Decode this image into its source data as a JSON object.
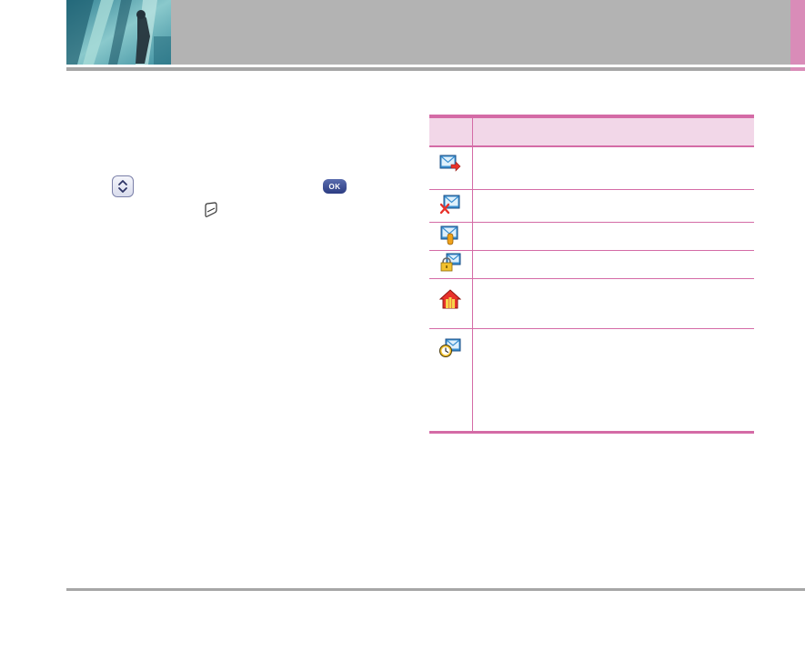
{
  "header": {
    "title": "",
    "photo_icon": "header-photo-icon"
  },
  "body_text": {
    "intro": ""
  },
  "keys": {
    "nav_key_icon": "nav-up-down-key-icon",
    "ok_key_label": "OK",
    "soft_key_icon": "soft-key-icon"
  },
  "icon_table": {
    "headers": [
      "",
      ""
    ],
    "rows": [
      {
        "icon": "message-sent-icon",
        "description": ""
      },
      {
        "icon": "message-failed-icon",
        "description": ""
      },
      {
        "icon": "message-read-icon",
        "description": ""
      },
      {
        "icon": "message-locked-icon",
        "description": ""
      },
      {
        "icon": "message-priority-icon",
        "description": ""
      },
      {
        "icon": "message-scheduled-icon",
        "description": ""
      }
    ]
  },
  "colors": {
    "header_gray": "#b3b3b3",
    "accent_pink": "#d98cb8",
    "table_line_pink": "#d46ba6",
    "table_header_fill": "#f2d7e8",
    "rule_gray": "#a6a6a6"
  }
}
